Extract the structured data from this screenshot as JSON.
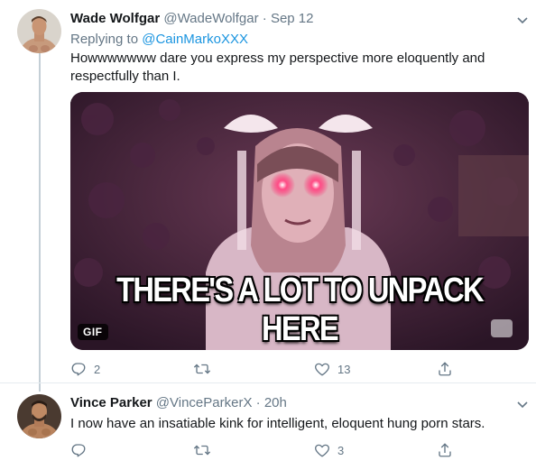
{
  "tweets": [
    {
      "author": "Wade Wolfgar",
      "handle": "@WadeWolfgar",
      "separator": "·",
      "time": "Sep 12",
      "reply_prefix": "Replying to",
      "reply_to": "@CainMarkoXXX",
      "text": "Howwwwwww dare you express my perspective more eloquently and respectfully than I.",
      "media": {
        "caption": "THERE'S A LOT TO UNPACK HERE",
        "badge": "GIF"
      },
      "actions": {
        "reply_icon": "reply-icon",
        "reply_count": "2",
        "retweet_icon": "retweet-icon",
        "like_icon": "heart-icon",
        "like_count": "13",
        "share_icon": "share-icon"
      }
    },
    {
      "author": "Vince Parker",
      "handle": "@VinceParkerX",
      "separator": "·",
      "time": "20h",
      "text": "I now have an insatiable kink for intelligent, eloquent hung porn stars.",
      "actions": {
        "reply_icon": "reply-icon",
        "retweet_icon": "retweet-icon",
        "like_icon": "heart-icon",
        "like_count": "3",
        "share_icon": "share-icon"
      }
    }
  ],
  "colors": {
    "text": "#14171a",
    "secondary": "#657786",
    "link": "#1b95e0",
    "divider": "#e6ecf0",
    "thread_line": "#c4cfd6"
  }
}
